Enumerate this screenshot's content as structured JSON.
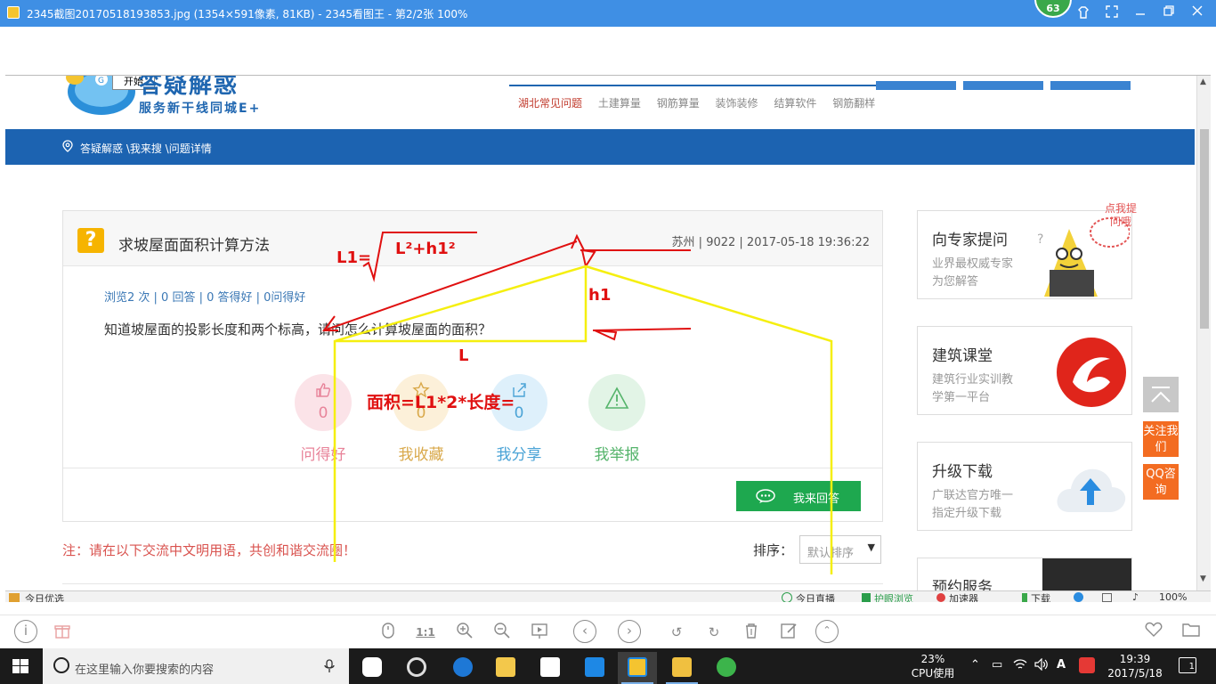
{
  "viewer": {
    "title": "2345截图20170518193853.jpg (1354×591像素, 81KB) - 2345看图王 - 第2/2张 100%",
    "badge_count": "63",
    "toolbar": {
      "one_to_one": "1:1"
    }
  },
  "webpage": {
    "start_tip": "开始",
    "logo_text": "答疑解惑",
    "logo_sub": "服务新干线同城E+",
    "hot_links": [
      "湖北常见问题",
      "土建算量",
      "钢筋算量",
      "装饰装修",
      "结算软件",
      "钢筋翻样"
    ],
    "breadcrumb": "答疑解惑 \\我来搜 \\问题详情",
    "question": {
      "title": "求坡屋面面积计算方法",
      "meta": "苏州 | 9022 | 2017-05-18 19:36:22",
      "stats": "浏览2 次 | 0 回答 | 0 答得好 | 0问得好",
      "body": "知道坡屋面的投影长度和两个标高，请问怎么计算坡屋面的面积？"
    },
    "actions": [
      {
        "label": "问得好",
        "count": "0",
        "color": "#e8849a",
        "bg": "#fbe3e8"
      },
      {
        "label": "我收藏",
        "count": "0",
        "color": "#d9a94b",
        "bg": "#fcf0d9"
      },
      {
        "label": "我分享",
        "count": "0",
        "color": "#4aa3d6",
        "bg": "#def0fb"
      },
      {
        "label": "我举报",
        "count": "",
        "color": "#55b46b",
        "bg": "#e2f4e6"
      }
    ],
    "answer_button": "我来回答",
    "notice": "注：请在以下交流中文明用语，共创和谐交流圈！",
    "sort_label": "排序：",
    "sort_value": "默认排序",
    "sidebar": [
      {
        "title": "向专家提问",
        "line1": "业界最权威专家",
        "line2": "为您解答",
        "bubble": "点我提问哦"
      },
      {
        "title": "建筑课堂",
        "line1": "建筑行业实训教",
        "line2": "学第一平台"
      },
      {
        "title": "升级下载",
        "line1": "广联达官方唯一",
        "line2": "指定升级下载"
      },
      {
        "title": "预约服务",
        "line1": "",
        "line2": ""
      }
    ],
    "float_buttons": [
      "关注我们",
      "QQ咨询"
    ],
    "statusbar": {
      "left": "今日优选",
      "live": "今日直播",
      "eye": "护眼浏览",
      "speed": "加速器",
      "download": "下载",
      "zoom": "100%"
    }
  },
  "annotations": {
    "formula_l1": "L1=",
    "formula_root": "L²+h1²",
    "label_h1": "h1",
    "label_l": "L",
    "formula_area": "面积=L1*2*长度="
  },
  "taskbar": {
    "search_placeholder": "在这里输入你要搜索的内容",
    "cpu_percent": "23%",
    "cpu_label": "CPU使用",
    "time": "19:39",
    "date": "2017/5/18",
    "notify_count": "1",
    "ime": "A"
  }
}
